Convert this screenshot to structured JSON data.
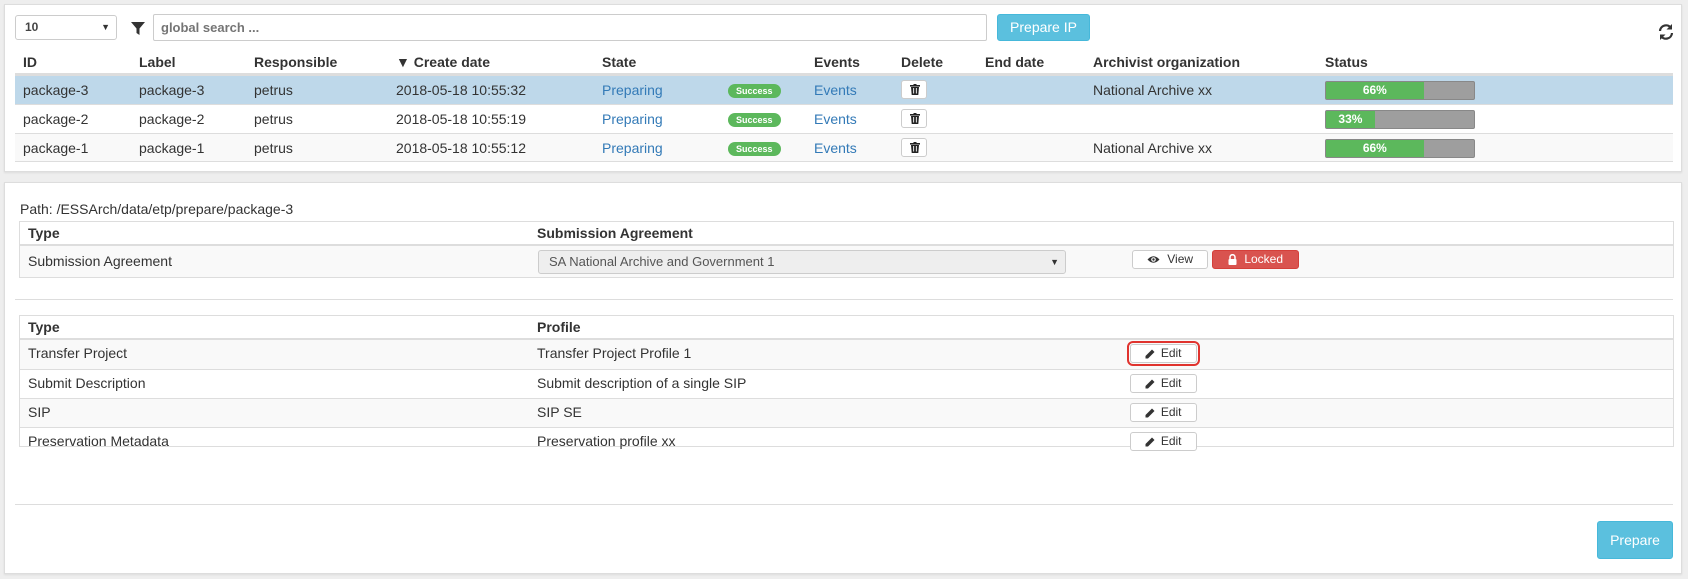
{
  "toolbar": {
    "page_size": "10",
    "search_placeholder": "global search ...",
    "prepare_ip_label": "Prepare IP"
  },
  "ip_table": {
    "headers": {
      "id": "ID",
      "label": "Label",
      "responsible": "Responsible",
      "create_date": "▼ Create date",
      "state": "State",
      "events": "Events",
      "delete": "Delete",
      "end_date": "End date",
      "archivist": "Archivist organization",
      "status": "Status"
    },
    "rows": [
      {
        "id": "package-3",
        "label": "package-3",
        "responsible": "petrus",
        "create_date": "2018-05-18 10:55:32",
        "state": "Preparing",
        "badge": "Success",
        "events": "Events",
        "end_date": "",
        "archivist": "National Archive xx",
        "progress_label": "66%",
        "progress": 0.66
      },
      {
        "id": "package-2",
        "label": "package-2",
        "responsible": "petrus",
        "create_date": "2018-05-18 10:55:19",
        "state": "Preparing",
        "badge": "Success",
        "events": "Events",
        "end_date": "",
        "archivist": "",
        "progress_label": "33%",
        "progress": 0.33
      },
      {
        "id": "package-1",
        "label": "package-1",
        "responsible": "petrus",
        "create_date": "2018-05-18 10:55:12",
        "state": "Preparing",
        "badge": "Success",
        "events": "Events",
        "end_date": "",
        "archivist": "National Archive xx",
        "progress_label": "66%",
        "progress": 0.66
      }
    ]
  },
  "detail": {
    "path": "Path: /ESSArch/data/etp/prepare/package-3",
    "sa_table": {
      "header_type": "Type",
      "header_sa": "Submission Agreement",
      "row_type": "Submission Agreement",
      "selected_sa": "SA National Archive and Government 1",
      "view_label": "View",
      "locked_label": "Locked"
    },
    "profile_table": {
      "header_type": "Type",
      "header_profile": "Profile",
      "rows": [
        {
          "type": "Transfer Project",
          "profile": "Transfer Project Profile 1",
          "edit_label": "Edit"
        },
        {
          "type": "Submit Description",
          "profile": "Submit description of a single SIP",
          "edit_label": "Edit"
        },
        {
          "type": "SIP",
          "profile": "SIP SE",
          "edit_label": "Edit"
        },
        {
          "type": "Preservation Metadata",
          "profile": "Preservation profile xx",
          "edit_label": "Edit"
        }
      ]
    },
    "prepare_label": "Prepare"
  },
  "colors": {
    "info": "#5bc0de",
    "success": "#5cb85c",
    "danger": "#d9534f",
    "link": "#337ab7",
    "selected_row": "#bed8ea",
    "highlight": "#e0332e"
  },
  "icons": {
    "filter": "filter-icon",
    "refresh": "refresh-icon",
    "delete": "trash-icon",
    "view": "eye-icon",
    "locked": "lock-icon",
    "edit": "pencil-icon"
  }
}
